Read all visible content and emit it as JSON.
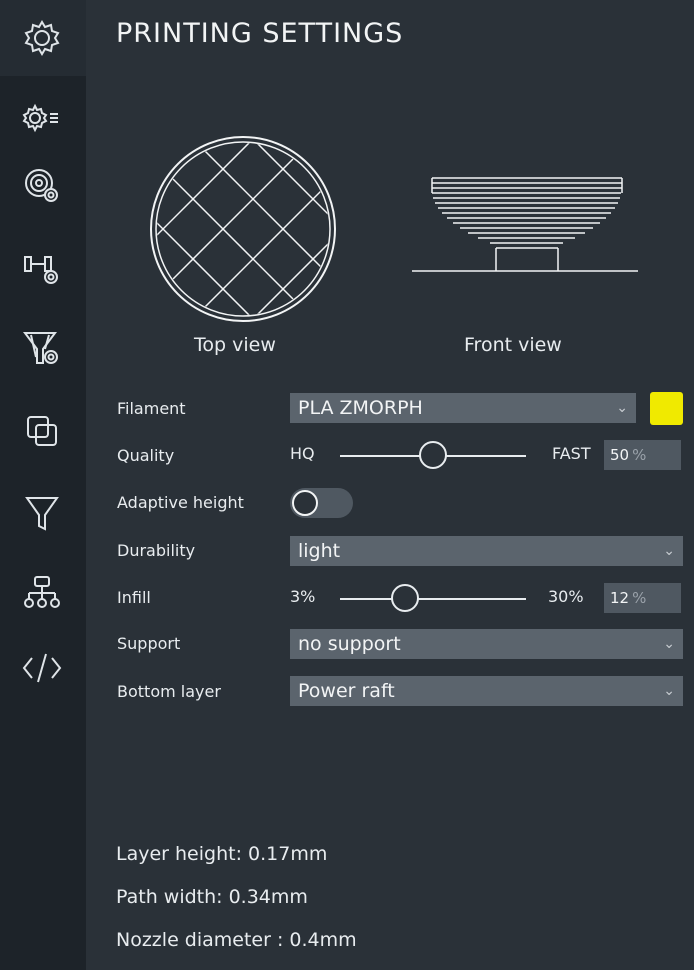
{
  "header": {
    "title": "PRINTING SETTINGS"
  },
  "sidebar": {
    "items": [
      {
        "icon": "gear-icon"
      },
      {
        "icon": "gear-list-icon"
      },
      {
        "icon": "spool-gear-icon"
      },
      {
        "icon": "extruder-gear-icon"
      },
      {
        "icon": "funnel-gear-icon"
      },
      {
        "icon": "overlap-squares-icon"
      },
      {
        "icon": "funnel-icon"
      },
      {
        "icon": "hierarchy-icon"
      },
      {
        "icon": "code-icon"
      }
    ]
  },
  "preview": {
    "top_label": "Top view",
    "front_label": "Front view"
  },
  "settings": {
    "filament": {
      "label": "Filament",
      "value": "PLA ZMORPH",
      "color": "#f0ea00"
    },
    "quality": {
      "label": "Quality",
      "min_label": "HQ",
      "max_label": "FAST",
      "value": "50",
      "unit": "%",
      "position": 0.5
    },
    "adaptive_height": {
      "label": "Adaptive height",
      "enabled": false
    },
    "durability": {
      "label": "Durability",
      "value": "light"
    },
    "infill": {
      "label": "Infill",
      "min_label": "3%",
      "max_label": "30%",
      "value": "12",
      "unit": "%",
      "position": 0.35
    },
    "support": {
      "label": "Support",
      "value": "no support"
    },
    "bottom_layer": {
      "label": "Bottom layer",
      "value": "Power raft"
    }
  },
  "info": {
    "layer_height": "Layer height: 0.17mm",
    "path_width": "Path width: 0.34mm",
    "nozzle_diameter": "Nozzle diameter : 0.4mm"
  }
}
